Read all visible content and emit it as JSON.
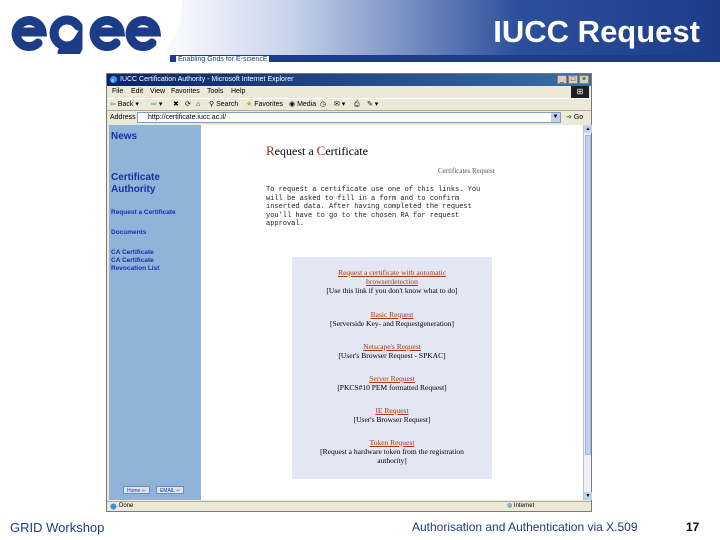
{
  "slide": {
    "title": "IUCC Request",
    "tagline": "Enabling Grids for E-sciencE",
    "logo_text": "egee",
    "footer_left": "GRID Workshop",
    "footer_center": "Authorisation and Authentication via X.509",
    "page_number": "17",
    "colors": {
      "brand_blue": "#1d3c88",
      "sidebar_blue": "#8fb3d9",
      "link_red": "#a8391a"
    }
  },
  "browser": {
    "window_title": "IUCC Certification Authority - Microsoft Internet Explorer",
    "window_buttons": [
      "_",
      "□",
      "×"
    ],
    "menu": [
      "File",
      "Edit",
      "View",
      "Favorites",
      "Tools",
      "Help"
    ],
    "toolbar": {
      "back": "Back",
      "search": "Search",
      "favorites": "Favorites",
      "media": "Media"
    },
    "address_label": "Address",
    "address_value": "http://certificate.iucc.ac.il/",
    "go_label": "Go",
    "status_text": "Done",
    "zone_text": "Internet"
  },
  "page": {
    "sidebar": {
      "news": "News",
      "certificate_authority_line1": "Certificate",
      "certificate_authority_line2": "Authority",
      "request_certificate": "Request a Certificate",
      "documents": "Documents",
      "ca_certificate": "CA Certificate",
      "ca_revocation_line1": "CA Certificate",
      "ca_revocation_line2": "Revocation List",
      "home": "Home",
      "email": "EMAIL"
    },
    "heading_first": "R",
    "heading_mid": "equest a ",
    "heading_cap2": "C",
    "heading_rest": "ertificate",
    "section_label": "Certificates Request",
    "instructions": [
      "To request a certificate use one of this links. You",
      "will be asked to fill in a form and to confirm",
      "inserted data. After having completed the request",
      "you'll have to go to the chosen RA for request",
      "approval."
    ],
    "requests": [
      {
        "link": [
          "Request a certificate with automatic",
          "browserdetection"
        ],
        "desc": [
          "[Use this link if you don't know what to do]"
        ]
      },
      {
        "link": [
          "Basic Request"
        ],
        "desc": [
          "[Serverside Key- and Requestgeneration]"
        ]
      },
      {
        "link": [
          "Netscape's Request"
        ],
        "desc": [
          "[User's Browser Request - SPKAC]"
        ]
      },
      {
        "link": [
          "Server Request"
        ],
        "desc": [
          "[PKCS#10 PEM formatted Request]"
        ]
      },
      {
        "link": [
          "IE Request"
        ],
        "desc": [
          "[User's Browser Request]"
        ]
      },
      {
        "link": [
          "Token Request"
        ],
        "desc": [
          "[Request a hardware token from the registration",
          "authority]"
        ]
      }
    ]
  }
}
